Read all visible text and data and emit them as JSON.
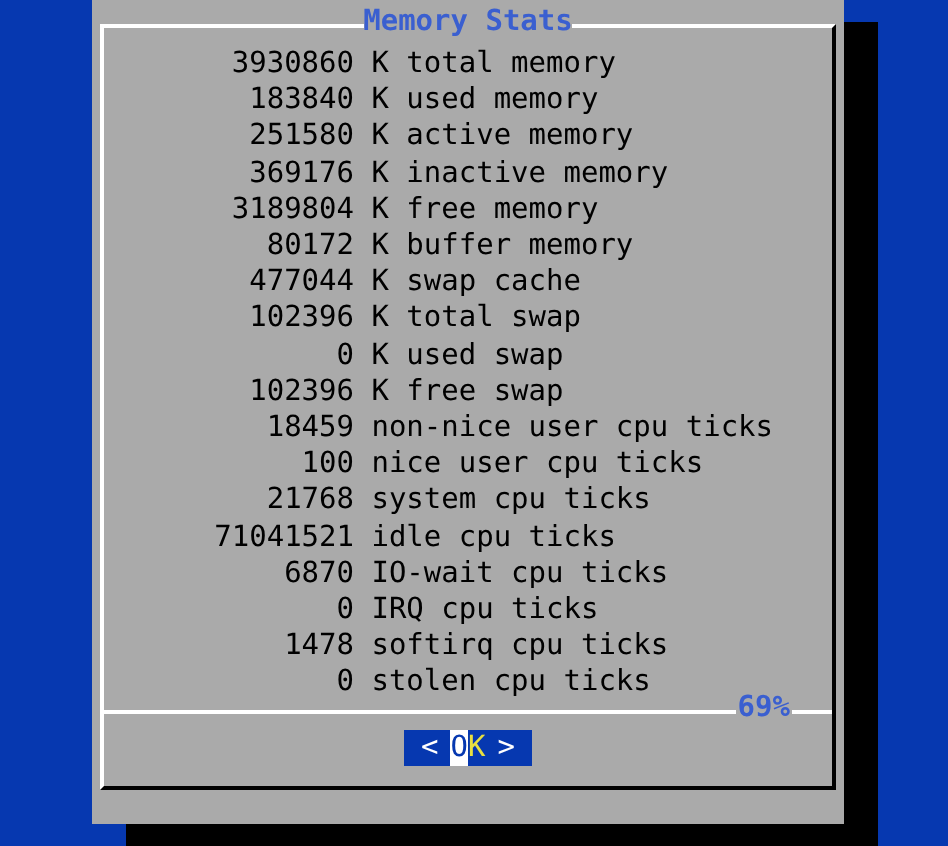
{
  "dialog": {
    "title": "Memory Stats",
    "lines": [
      {
        "number": "3930860",
        "text": "K total memory"
      },
      {
        "number": "183840",
        "text": "K used memory"
      },
      {
        "number": "251580",
        "text": "K active memory"
      },
      {
        "number": "369176",
        "text": "K inactive memory"
      },
      {
        "number": "3189804",
        "text": "K free memory"
      },
      {
        "number": "80172",
        "text": "K buffer memory"
      },
      {
        "number": "477044",
        "text": "K swap cache"
      },
      {
        "number": "102396",
        "text": "K total swap"
      },
      {
        "number": "0",
        "text": "K used swap"
      },
      {
        "number": "102396",
        "text": "K free swap"
      },
      {
        "number": "18459",
        "text": "non-nice user cpu ticks"
      },
      {
        "number": "100",
        "text": "nice user cpu ticks"
      },
      {
        "number": "21768",
        "text": "system cpu ticks"
      },
      {
        "number": "71041521",
        "text": "idle cpu ticks"
      },
      {
        "number": "6870",
        "text": "IO-wait cpu ticks"
      },
      {
        "number": "0",
        "text": "IRQ cpu ticks"
      },
      {
        "number": "1478",
        "text": "softirq cpu ticks"
      },
      {
        "number": "0",
        "text": "stolen cpu ticks"
      }
    ],
    "scroll_percent": "69%",
    "button": {
      "left": "<",
      "label": "OK",
      "right": ">",
      "selected": true
    }
  }
}
